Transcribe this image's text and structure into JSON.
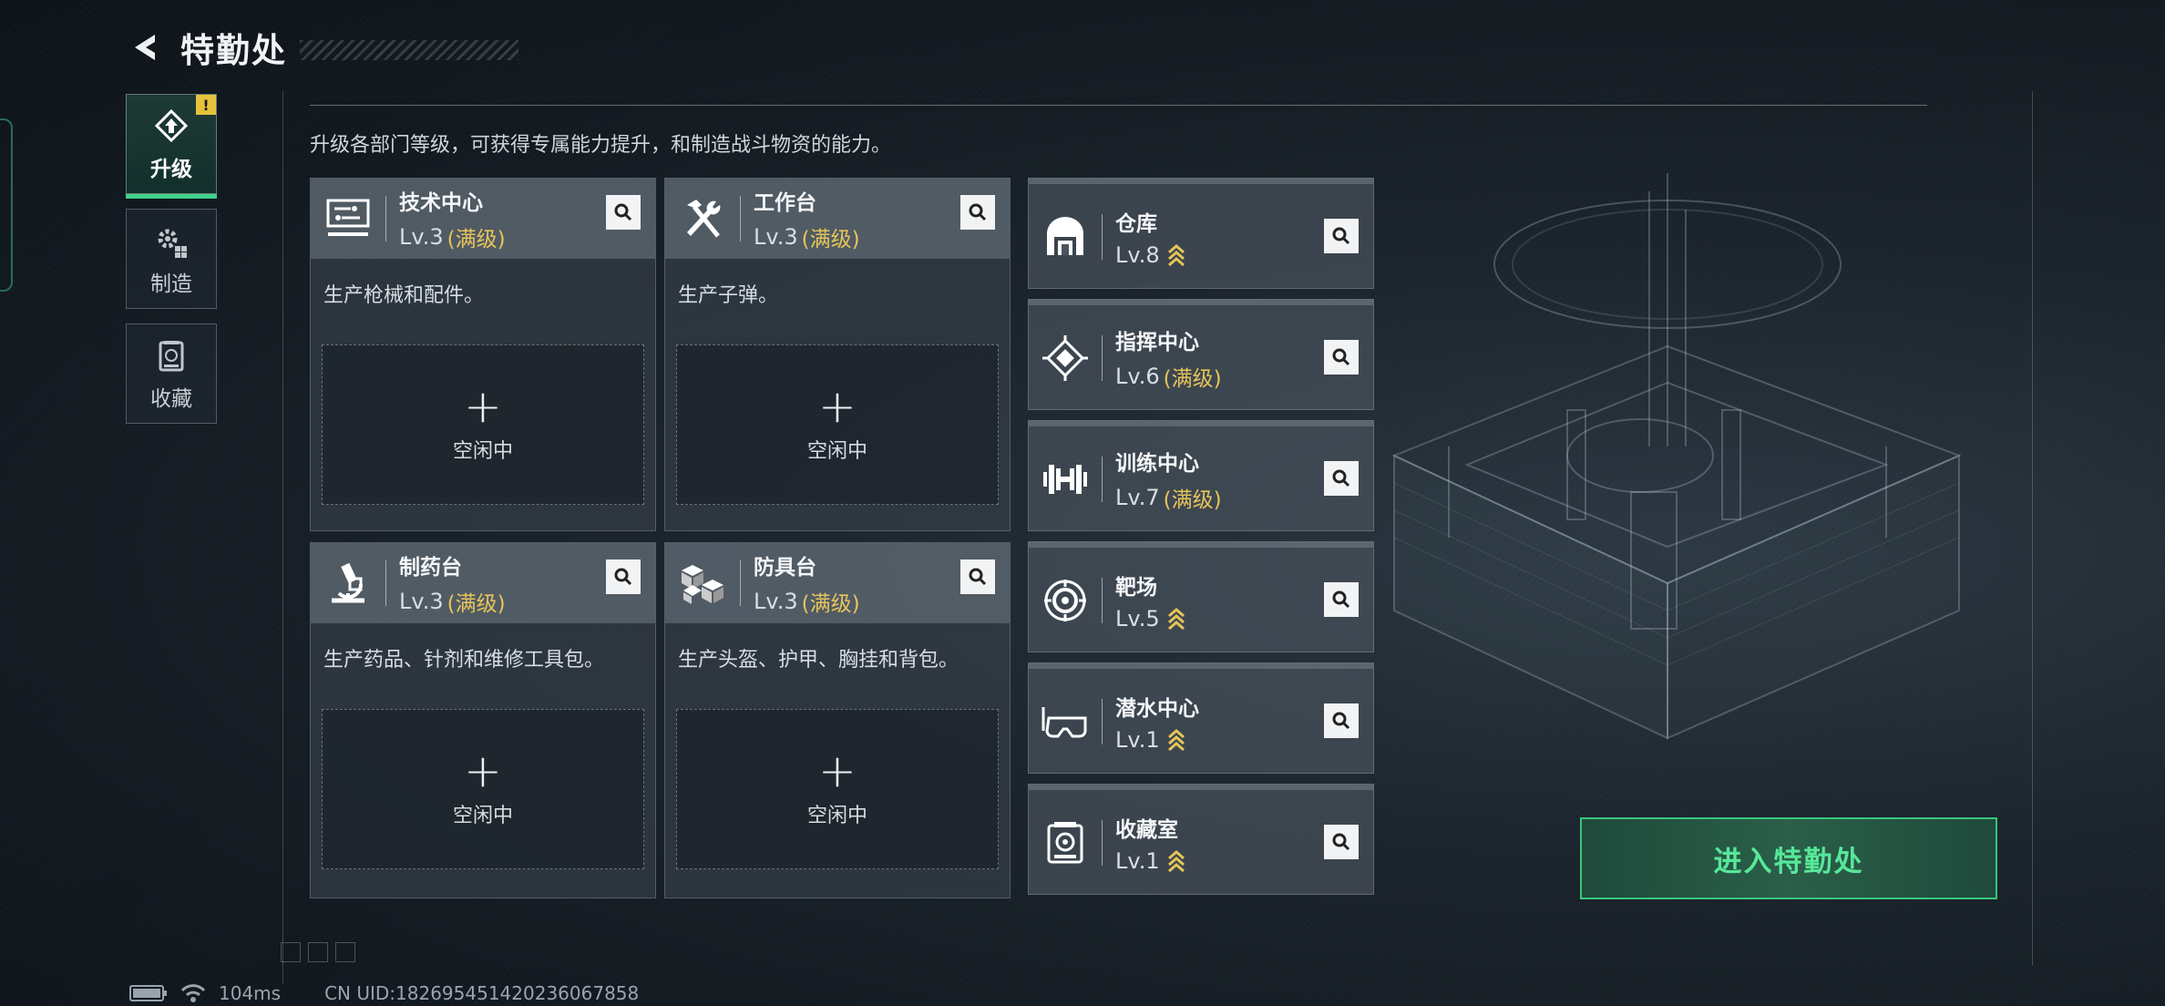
{
  "header": {
    "title": "特勤处"
  },
  "nav": {
    "items": [
      {
        "label": "升级",
        "active": true,
        "badge": "!"
      },
      {
        "label": "制造",
        "active": false
      },
      {
        "label": "收藏",
        "active": false
      }
    ]
  },
  "description": "升级各部门等级，可获得专属能力提升，和制造战斗物资的能力。",
  "cards": [
    {
      "name": "技术中心",
      "level": "Lv.3",
      "max_label": "(满级)",
      "desc": "生产枪械和配件。",
      "slot_label": "空闲中",
      "slot_plus": "+",
      "icon": "computer-icon"
    },
    {
      "name": "工作台",
      "level": "Lv.3",
      "max_label": "(满级)",
      "desc": "生产子弹。",
      "slot_label": "空闲中",
      "slot_plus": "+",
      "icon": "tools-icon"
    },
    {
      "name": "制药台",
      "level": "Lv.3",
      "max_label": "(满级)",
      "desc": "生产药品、针剂和维修工具包。",
      "slot_label": "空闲中",
      "slot_plus": "+",
      "icon": "microscope-icon"
    },
    {
      "name": "防具台",
      "level": "Lv.3",
      "max_label": "(满级)",
      "desc": "生产头盔、护甲、胸挂和背包。",
      "slot_label": "空闲中",
      "slot_plus": "+",
      "icon": "boxes-icon"
    }
  ],
  "facilities": [
    {
      "name": "仓库",
      "level": "Lv.8",
      "max_label": "",
      "upgradable": true,
      "icon": "warehouse-icon"
    },
    {
      "name": "指挥中心",
      "level": "Lv.6",
      "max_label": "(满级)",
      "upgradable": false,
      "icon": "chip-icon"
    },
    {
      "name": "训练中心",
      "level": "Lv.7",
      "max_label": "(满级)",
      "upgradable": false,
      "icon": "dumbbell-icon"
    },
    {
      "name": "靶场",
      "level": "Lv.5",
      "max_label": "",
      "upgradable": true,
      "icon": "target-icon"
    },
    {
      "name": "潜水中心",
      "level": "Lv.1",
      "max_label": "",
      "upgradable": true,
      "icon": "goggles-icon"
    },
    {
      "name": "收藏室",
      "level": "Lv.1",
      "max_label": "",
      "upgradable": true,
      "icon": "vault-icon"
    }
  ],
  "enter_button": "进入特勤处",
  "status": {
    "ping": "104ms",
    "uid": "CN UID:18269545142023606785​8"
  },
  "colors": {
    "accent_green": "#37c77d",
    "max_level_gold": "#e6c45a",
    "warning": "#e6c23c"
  }
}
